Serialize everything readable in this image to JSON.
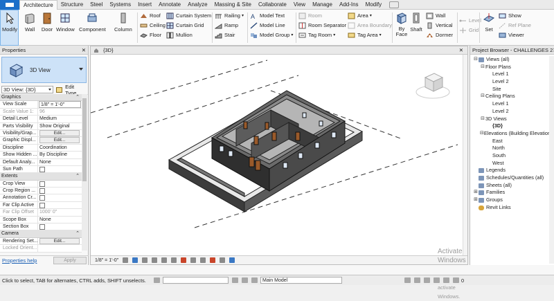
{
  "ribbon_tabs": [
    "Architecture",
    "Structure",
    "Steel",
    "Systems",
    "Insert",
    "Annotate",
    "Analyze",
    "Massing & Site",
    "Collaborate",
    "View",
    "Manage",
    "Add-Ins",
    "Modify"
  ],
  "ribbon": {
    "modify": "Modify",
    "wall": "Wall",
    "door": "Door",
    "window": "Window",
    "component": "Component",
    "column": "Column",
    "roof": "Roof",
    "ceiling": "Ceiling",
    "floor": "Floor",
    "curtain_system": "Curtain System",
    "curtain_grid": "Curtain Grid",
    "mullion": "Mullion",
    "railing": "Railing",
    "ramp": "Ramp",
    "stair": "Stair",
    "model_text": "Model Text",
    "model_line": "Model Line",
    "model_group": "Model Group",
    "room": "Room",
    "room_separator": "Room Separator",
    "tag_room": "Tag Room",
    "area": "Area",
    "area_boundary": "Area Boundary",
    "tag_area": "Tag Area",
    "by_face": "By\nFace",
    "shaft": "Shaft",
    "wall_opening": "Wall",
    "vertical": "Vertical",
    "dormer": "Dormer",
    "level": "Level",
    "grid": "Grid",
    "set": "Set",
    "show": "Show",
    "ref_plane": "Ref Plane",
    "viewer": "Viewer"
  },
  "properties": {
    "title": "Properties",
    "type_name": "3D View",
    "selector": "3D View: {3D}",
    "edit_type": "Edit Type",
    "groups": [
      {
        "name": "Graphics",
        "rows": [
          {
            "k": "View Scale",
            "v": "1/8\" = 1'-0\"",
            "kind": "input"
          },
          {
            "k": "Scale Value    1:",
            "v": "96",
            "kind": "dim"
          },
          {
            "k": "Detail Level",
            "v": "Medium",
            "kind": "text"
          },
          {
            "k": "Parts Visibility",
            "v": "Show Original",
            "kind": "text"
          },
          {
            "k": "Visibility/Grap...",
            "v": "Edit...",
            "kind": "button"
          },
          {
            "k": "Graphic Displ...",
            "v": "Edit...",
            "kind": "button"
          },
          {
            "k": "Discipline",
            "v": "Coordination",
            "kind": "text"
          },
          {
            "k": "Show Hidden ...",
            "v": "By Discipline",
            "kind": "text"
          },
          {
            "k": "Default Analy...",
            "v": "None",
            "kind": "text"
          },
          {
            "k": "Sun Path",
            "v": "",
            "kind": "check"
          }
        ]
      },
      {
        "name": "Extents",
        "rows": [
          {
            "k": "Crop View",
            "v": "",
            "kind": "check"
          },
          {
            "k": "Crop Region ...",
            "v": "",
            "kind": "check"
          },
          {
            "k": "Annotation Cr...",
            "v": "",
            "kind": "check"
          },
          {
            "k": "Far Clip Active",
            "v": "",
            "kind": "check"
          },
          {
            "k": "Far Clip Offset",
            "v": "1000'  0\"",
            "kind": "dim"
          },
          {
            "k": "Scope Box",
            "v": "None",
            "kind": "text"
          },
          {
            "k": "Section Box",
            "v": "",
            "kind": "check"
          }
        ]
      },
      {
        "name": "Camera",
        "rows": [
          {
            "k": "Rendering Set...",
            "v": "Edit...",
            "kind": "button"
          },
          {
            "k": "Locked Orient...",
            "v": "",
            "kind": "dim"
          }
        ]
      }
    ],
    "help": "Properties help",
    "apply": "Apply"
  },
  "viewport": {
    "tab": "{3D}",
    "scale": "1/8\" = 1'-0\""
  },
  "browser": {
    "title": "Project Browser - CHALLENGES 2",
    "nodes": [
      {
        "label": "Views (all)",
        "depth": 0,
        "toggle": "⊟",
        "bold": false
      },
      {
        "label": "Floor Plans",
        "depth": 1,
        "toggle": "⊟"
      },
      {
        "label": "Level 1",
        "depth": 2,
        "toggle": ""
      },
      {
        "label": "Level 2",
        "depth": 2,
        "toggle": ""
      },
      {
        "label": "Site",
        "depth": 2,
        "toggle": ""
      },
      {
        "label": "Ceiling Plans",
        "depth": 1,
        "toggle": "⊟"
      },
      {
        "label": "Level 1",
        "depth": 2,
        "toggle": ""
      },
      {
        "label": "Level 2",
        "depth": 2,
        "toggle": ""
      },
      {
        "label": "3D Views",
        "depth": 1,
        "toggle": "⊟"
      },
      {
        "label": "{3D}",
        "depth": 2,
        "toggle": "",
        "bold": true
      },
      {
        "label": "Elevations (Building Elevation)",
        "depth": 1,
        "toggle": "⊟"
      },
      {
        "label": "East",
        "depth": 2,
        "toggle": ""
      },
      {
        "label": "North",
        "depth": 2,
        "toggle": ""
      },
      {
        "label": "South",
        "depth": 2,
        "toggle": ""
      },
      {
        "label": "West",
        "depth": 2,
        "toggle": ""
      },
      {
        "label": "Legends",
        "depth": 0,
        "toggle": "",
        "icon": true
      },
      {
        "label": "Schedules/Quantities (all)",
        "depth": 0,
        "toggle": "",
        "icon": true
      },
      {
        "label": "Sheets (all)",
        "depth": 0,
        "toggle": "",
        "icon": true
      },
      {
        "label": "Families",
        "depth": 0,
        "toggle": "⊞"
      },
      {
        "label": "Groups",
        "depth": 0,
        "toggle": "⊞"
      },
      {
        "label": "Revit Links",
        "depth": 0,
        "toggle": "",
        "link": true
      }
    ]
  },
  "watermark": {
    "line1": "Activate Windows",
    "line2": "Go to Settings to activate Windows."
  },
  "status": {
    "message": "Click to select, TAB for alternates, CTRL adds, SHIFT unselects.",
    "model": "Main Model",
    "filter": "0"
  }
}
